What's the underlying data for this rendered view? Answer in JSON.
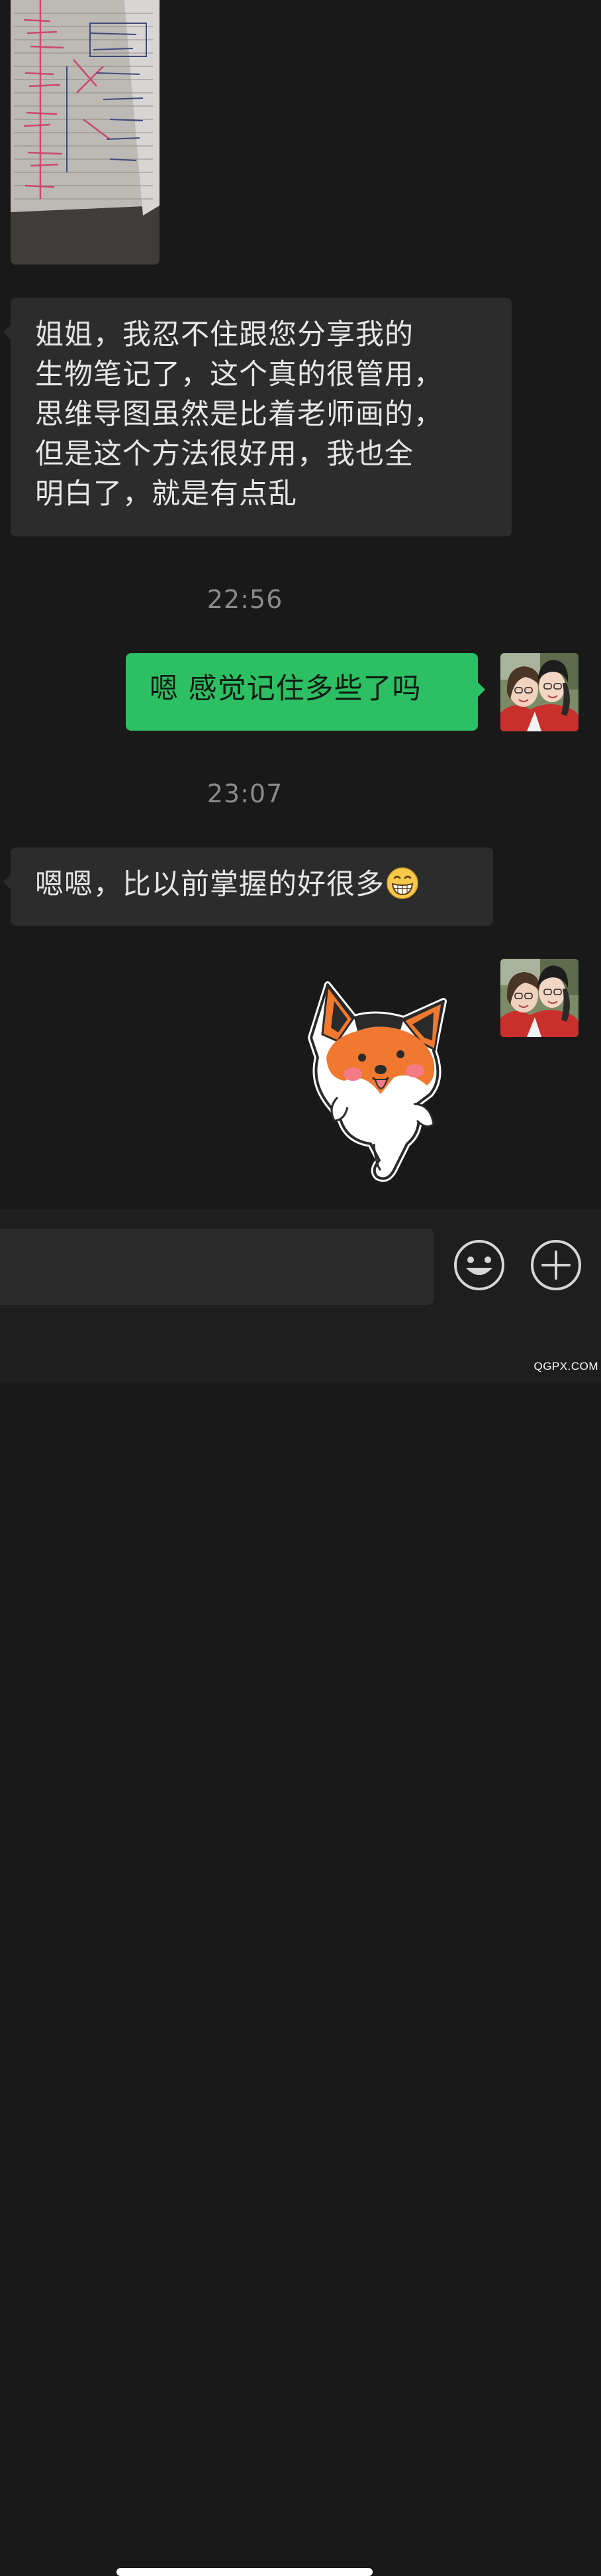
{
  "chat": {
    "messages": [
      {
        "id": "msg1",
        "side": "left",
        "lines": [
          "姐姐，我忍不住跟您分享我的",
          "生物笔记了，这个真的很管用，",
          "思维导图虽然是比着老师画的，",
          "但是这个方法很好用，我也全",
          "明白了，就是有点乱"
        ]
      },
      {
        "id": "msg2",
        "side": "right",
        "text": "嗯 感觉记住多些了吗"
      },
      {
        "id": "msg3",
        "side": "left",
        "text": "嗯嗯，比以前掌握的好很多",
        "emoji": "grinning-face-emoji"
      }
    ],
    "timestamps": [
      "22:56",
      "23:07"
    ],
    "image_message": {
      "icon": "handwritten-notebook-photo"
    },
    "sticker": {
      "icon": "corgi-sticker"
    },
    "avatar": {
      "icon": "avatar-photo"
    }
  },
  "input_bar": {
    "placeholder": "",
    "value": "",
    "emoji_button_icon": "smiley-icon",
    "more_button_icon": "plus-circle-icon"
  },
  "watermark": "QGPX.COM",
  "colors": {
    "background": "#191919",
    "left_bubble": "#2c2c2c",
    "right_bubble": "#2dbf63",
    "timestamp": "#8a8a8a"
  }
}
